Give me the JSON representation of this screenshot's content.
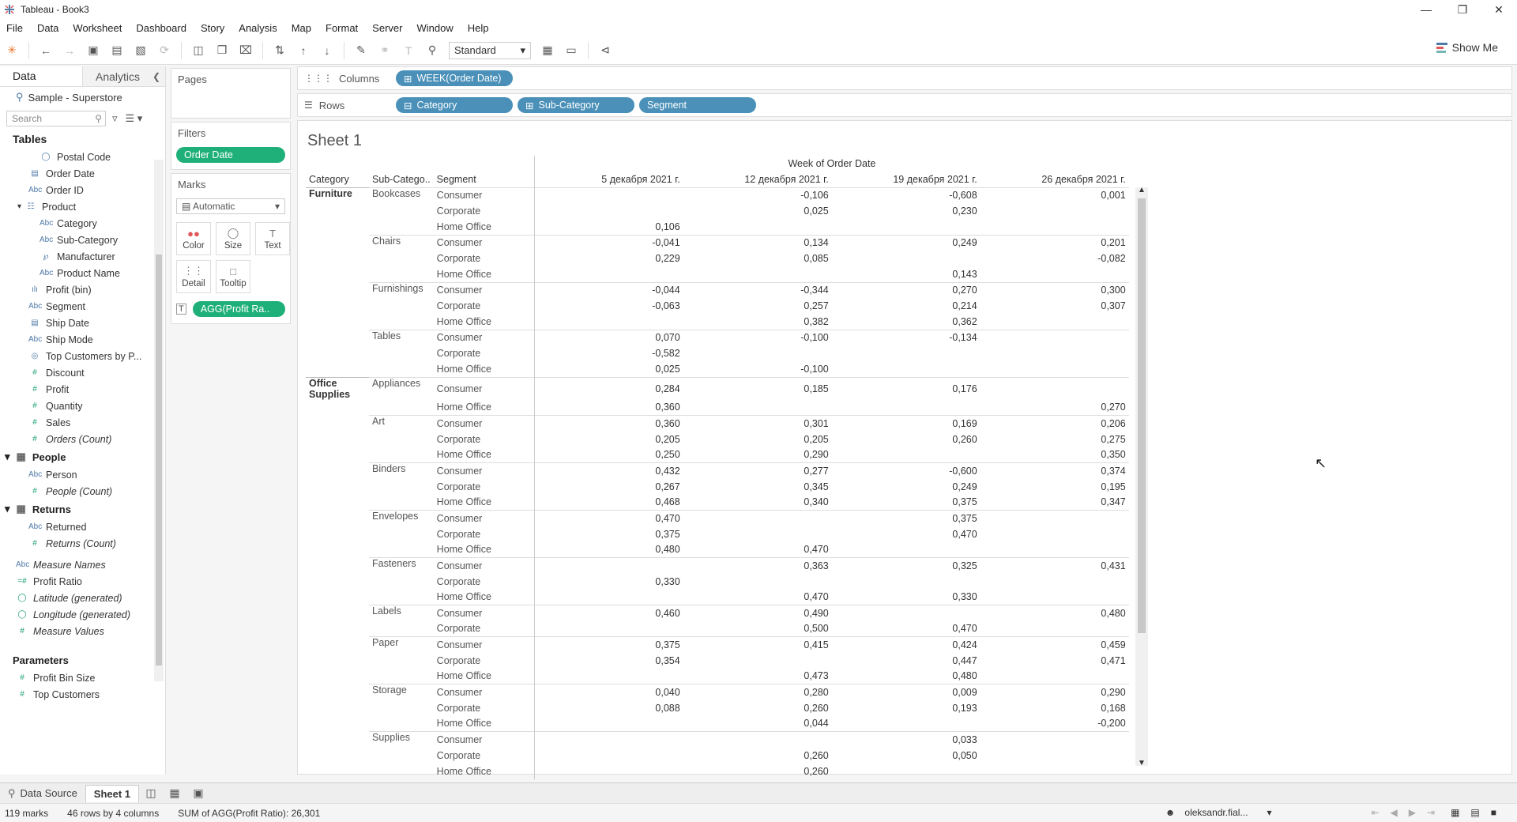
{
  "window": {
    "title": "Tableau - Book3"
  },
  "menu": [
    "File",
    "Data",
    "Worksheet",
    "Dashboard",
    "Story",
    "Analysis",
    "Map",
    "Format",
    "Server",
    "Window",
    "Help"
  ],
  "toolbar": {
    "fit_select": "Standard",
    "show_me": "Show Me"
  },
  "left": {
    "tab_data": "Data",
    "tab_analytics": "Analytics",
    "datasource": "Sample - Superstore",
    "search_placeholder": "Search",
    "tables_header": "Tables",
    "fields": [
      {
        "name": "Postal Code",
        "kind": "dim",
        "icon": "globe"
      },
      {
        "name": "Order Date",
        "kind": "dim",
        "icon": "calendar"
      },
      {
        "name": "Order ID",
        "kind": "dim",
        "icon": "abc"
      },
      {
        "name": "Product",
        "kind": "dim",
        "icon": "hierarchy"
      },
      {
        "name": "Category",
        "kind": "dim",
        "icon": "abc"
      },
      {
        "name": "Sub-Category",
        "kind": "dim",
        "icon": "abc"
      },
      {
        "name": "Manufacturer",
        "kind": "dim",
        "icon": "link"
      },
      {
        "name": "Product Name",
        "kind": "dim",
        "icon": "abc"
      },
      {
        "name": "Profit (bin)",
        "kind": "dim",
        "icon": "bin"
      },
      {
        "name": "Segment",
        "kind": "dim",
        "icon": "abc"
      },
      {
        "name": "Ship Date",
        "kind": "dim",
        "icon": "calendar"
      },
      {
        "name": "Ship Mode",
        "kind": "dim",
        "icon": "abc"
      },
      {
        "name": "Top Customers by P...",
        "kind": "dim",
        "icon": "set"
      },
      {
        "name": "Discount",
        "kind": "meas",
        "icon": "hash"
      },
      {
        "name": "Profit",
        "kind": "meas",
        "icon": "hash"
      },
      {
        "name": "Quantity",
        "kind": "meas",
        "icon": "hash"
      },
      {
        "name": "Sales",
        "kind": "meas",
        "icon": "hash"
      },
      {
        "name": "Orders (Count)",
        "kind": "meas",
        "icon": "hash"
      }
    ],
    "people_header": "People",
    "people_fields": [
      "Person",
      "People (Count)"
    ],
    "returns_header": "Returns",
    "returns_fields": [
      "Returned",
      "Returns (Count)"
    ],
    "extra_fields": [
      "Measure Names",
      "Profit Ratio",
      "Latitude (generated)",
      "Longitude (generated)",
      "Measure Values"
    ],
    "parameters_header": "Parameters",
    "parameters": [
      "Profit Bin Size",
      "Top Customers"
    ]
  },
  "cards": {
    "pages": "Pages",
    "filters": "Filters",
    "filter_pill": "Order Date",
    "marks": "Marks",
    "mark_type": "Automatic",
    "mark_buttons": [
      "Color",
      "Size",
      "Text",
      "Detail",
      "Tooltip"
    ],
    "marks_pill": "AGG(Profit Ra.."
  },
  "shelves": {
    "columns_label": "Columns",
    "rows_label": "Rows",
    "columns": [
      "WEEK(Order Date)"
    ],
    "rows": [
      "Category",
      "Sub-Category",
      "Segment"
    ]
  },
  "sheet": {
    "title": "Sheet 1",
    "top_header": "Week of Order Date",
    "row_headers": [
      "Category",
      "Sub-Catego..",
      "Segment"
    ],
    "weeks": [
      "5 декабря 2021 г.",
      "12 декабря 2021 г.",
      "19 декабря 2021 г.",
      "26 декабря 2021 г."
    ],
    "rows": [
      [
        "Furniture",
        "Bookcases",
        "Consumer",
        "",
        "-0,106",
        "-0,608",
        "0,001"
      ],
      [
        "",
        "",
        "Corporate",
        "",
        "0,025",
        "0,230",
        ""
      ],
      [
        "",
        "",
        "Home Office",
        "0,106",
        "",
        "",
        ""
      ],
      [
        "",
        "Chairs",
        "Consumer",
        "-0,041",
        "0,134",
        "0,249",
        "0,201"
      ],
      [
        "",
        "",
        "Corporate",
        "0,229",
        "0,085",
        "",
        "-0,082"
      ],
      [
        "",
        "",
        "Home Office",
        "",
        "",
        "0,143",
        ""
      ],
      [
        "",
        "Furnishings",
        "Consumer",
        "-0,044",
        "-0,344",
        "0,270",
        "0,300"
      ],
      [
        "",
        "",
        "Corporate",
        "-0,063",
        "0,257",
        "0,214",
        "0,307"
      ],
      [
        "",
        "",
        "Home Office",
        "",
        "0,382",
        "0,362",
        ""
      ],
      [
        "",
        "Tables",
        "Consumer",
        "0,070",
        "-0,100",
        "-0,134",
        ""
      ],
      [
        "",
        "",
        "Corporate",
        "-0,582",
        "",
        "",
        ""
      ],
      [
        "",
        "",
        "Home Office",
        "0,025",
        "-0,100",
        "",
        ""
      ],
      [
        "Office Supplies",
        "Appliances",
        "Consumer",
        "0,284",
        "0,185",
        "0,176",
        ""
      ],
      [
        "",
        "",
        "Home Office",
        "0,360",
        "",
        "",
        "0,270"
      ],
      [
        "",
        "Art",
        "Consumer",
        "0,360",
        "0,301",
        "0,169",
        "0,206"
      ],
      [
        "",
        "",
        "Corporate",
        "0,205",
        "0,205",
        "0,260",
        "0,275"
      ],
      [
        "",
        "",
        "Home Office",
        "0,250",
        "0,290",
        "",
        "0,350"
      ],
      [
        "",
        "Binders",
        "Consumer",
        "0,432",
        "0,277",
        "-0,600",
        "0,374"
      ],
      [
        "",
        "",
        "Corporate",
        "0,267",
        "0,345",
        "0,249",
        "0,195"
      ],
      [
        "",
        "",
        "Home Office",
        "0,468",
        "0,340",
        "0,375",
        "0,347"
      ],
      [
        "",
        "Envelopes",
        "Consumer",
        "0,470",
        "",
        "0,375",
        ""
      ],
      [
        "",
        "",
        "Corporate",
        "0,375",
        "",
        "0,470",
        ""
      ],
      [
        "",
        "",
        "Home Office",
        "0,480",
        "0,470",
        "",
        ""
      ],
      [
        "",
        "Fasteners",
        "Consumer",
        "",
        "0,363",
        "0,325",
        "0,431"
      ],
      [
        "",
        "",
        "Corporate",
        "0,330",
        "",
        "",
        ""
      ],
      [
        "",
        "",
        "Home Office",
        "",
        "0,470",
        "0,330",
        ""
      ],
      [
        "",
        "Labels",
        "Consumer",
        "0,460",
        "0,490",
        "",
        "0,480"
      ],
      [
        "",
        "",
        "Corporate",
        "",
        "0,500",
        "0,470",
        ""
      ],
      [
        "",
        "Paper",
        "Consumer",
        "0,375",
        "0,415",
        "0,424",
        "0,459"
      ],
      [
        "",
        "",
        "Corporate",
        "0,354",
        "",
        "0,447",
        "0,471"
      ],
      [
        "",
        "",
        "Home Office",
        "",
        "0,473",
        "0,480",
        ""
      ],
      [
        "",
        "Storage",
        "Consumer",
        "0,040",
        "0,280",
        "0,009",
        "0,290"
      ],
      [
        "",
        "",
        "Corporate",
        "0,088",
        "0,260",
        "0,193",
        "0,168"
      ],
      [
        "",
        "",
        "Home Office",
        "",
        "0,044",
        "",
        "-0,200"
      ],
      [
        "",
        "Supplies",
        "Consumer",
        "",
        "",
        "0,033",
        ""
      ],
      [
        "",
        "",
        "Corporate",
        "",
        "0,260",
        "0,050",
        ""
      ],
      [
        "",
        "",
        "Home Office",
        "",
        "0,260",
        "",
        ""
      ]
    ]
  },
  "bottom": {
    "data_source": "Data Source",
    "sheet_tab": "Sheet 1"
  },
  "status": {
    "marks": "119 marks",
    "rows_cols": "46 rows by 4 columns",
    "sum": "SUM of AGG(Profit Ratio): 26,301",
    "user": "oleksandr.fial..."
  }
}
